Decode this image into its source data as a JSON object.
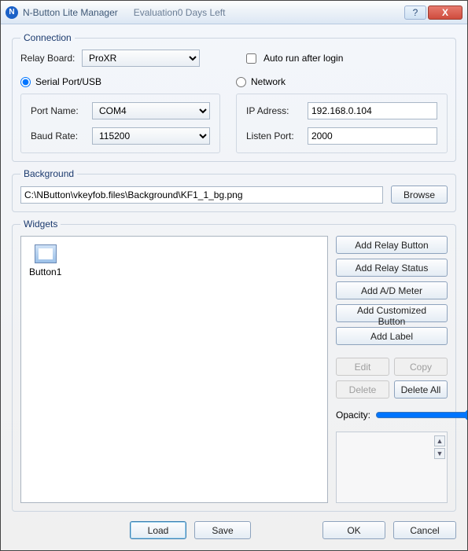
{
  "titlebar": {
    "app_title": "N-Button Lite Manager",
    "eval_text": "Evaluation0 Days Left",
    "help_glyph": "?",
    "close_glyph": "X"
  },
  "connection": {
    "legend": "Connection",
    "relay_board_label": "Relay Board:",
    "relay_board_value": "ProXR",
    "autorun_label": "Auto run after login",
    "serial_label": "Serial Port/USB",
    "network_label": "Network",
    "port_name_label": "Port Name:",
    "port_name_value": "COM4",
    "baud_rate_label": "Baud Rate:",
    "baud_rate_value": "115200",
    "ip_label": "IP Adress:",
    "ip_value": "192.168.0.104",
    "listen_port_label": "Listen Port:",
    "listen_port_value": "2000"
  },
  "background": {
    "legend": "Background",
    "path": "C:\\NButton\\vkeyfob.files\\Background\\KF1_1_bg.png",
    "browse": "Browse"
  },
  "widgets": {
    "legend": "Widgets",
    "item1_label": "Button1",
    "add_relay_button": "Add Relay Button",
    "add_relay_status": "Add Relay Status",
    "add_ad_meter": "Add A/D Meter",
    "add_custom_button": "Add Customized Button",
    "add_label": "Add Label",
    "edit": "Edit",
    "copy": "Copy",
    "delete": "Delete",
    "delete_all": "Delete All",
    "opacity_label": "Opacity:",
    "opacity_value": "100"
  },
  "bottom": {
    "load": "Load",
    "save": "Save",
    "ok": "OK",
    "cancel": "Cancel"
  }
}
